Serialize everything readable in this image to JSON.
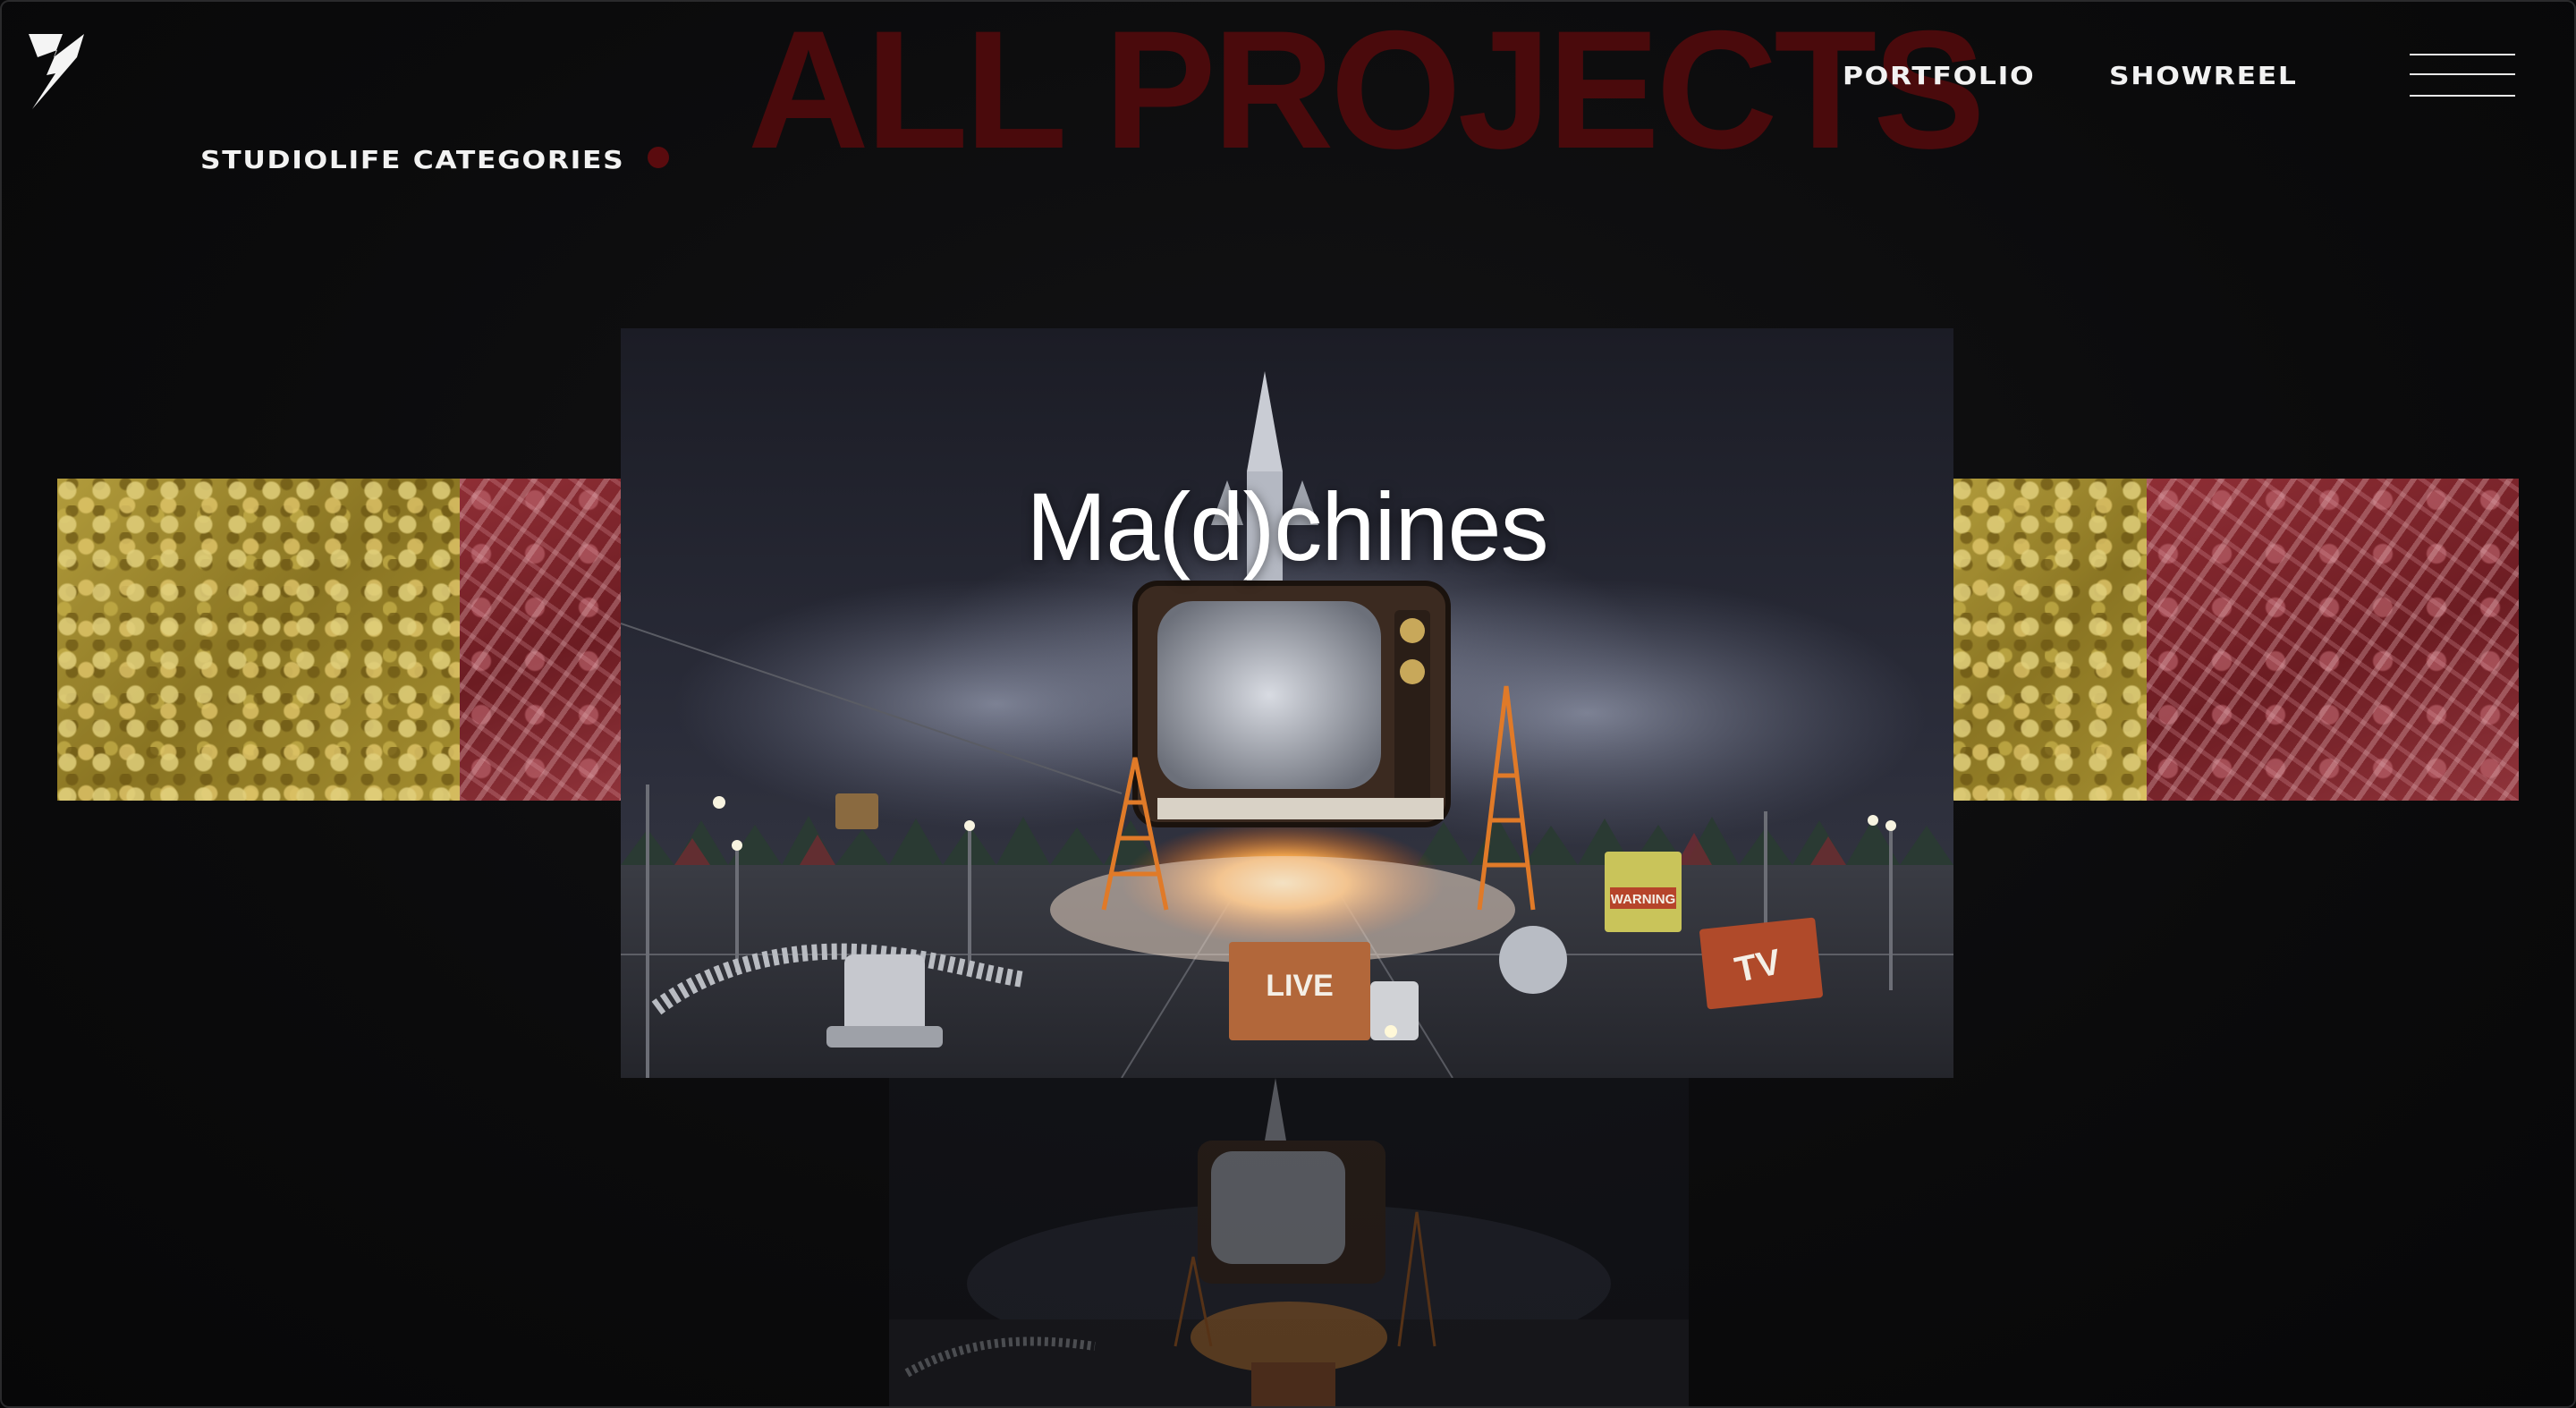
{
  "header": {
    "title": "ALL PROJECTS",
    "logo": "lightning-bolt-logo",
    "nav": [
      {
        "label": "PORTFOLIO"
      },
      {
        "label": "SHOWREEL"
      }
    ],
    "menu_icon": "hamburger-icon"
  },
  "subnav": {
    "label": "STUDIOLIFE CATEGORIES"
  },
  "carousel": {
    "featured": {
      "title": "Ma(d)chines",
      "truck_sign_1": "LIVE",
      "truck_sign_2": "TV",
      "billboard": "WARNING"
    }
  },
  "colors": {
    "background": "#0a0a0b",
    "title_red": "#4a0a0c",
    "dot_red": "#5a0b0e",
    "text": "#f2f2f2"
  }
}
